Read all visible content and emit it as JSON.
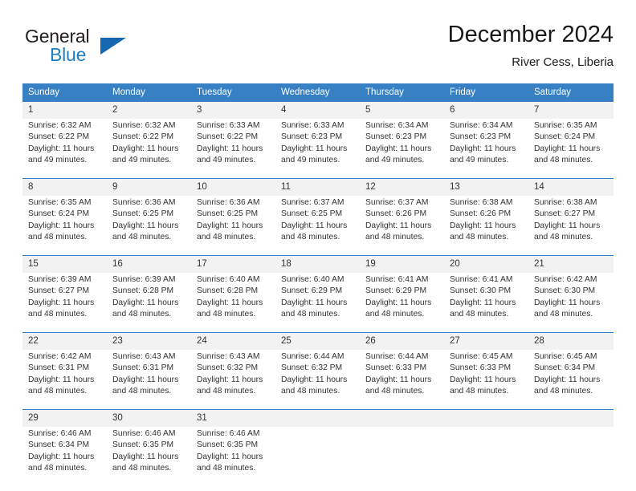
{
  "brand": {
    "name_part1": "General",
    "name_part2": "Blue",
    "triangle_color": "#1567ae",
    "blue_color": "#1f7ec2"
  },
  "header": {
    "title": "December 2024",
    "subtitle": "River Cess, Liberia"
  },
  "theme": {
    "header_bg": "#3780c3",
    "header_text": "#ffffff",
    "daynum_bg": "#f2f2f2",
    "separator": "#3780c3",
    "body_text": "#333333"
  },
  "weekdays": [
    "Sunday",
    "Monday",
    "Tuesday",
    "Wednesday",
    "Thursday",
    "Friday",
    "Saturday"
  ],
  "labels": {
    "sunrise_prefix": "Sunrise:",
    "sunset_prefix": "Sunset:",
    "daylight_prefix": "Daylight:"
  },
  "weeks": [
    [
      {
        "day": "1",
        "sunrise": "Sunrise: 6:32 AM",
        "sunset": "Sunset: 6:22 PM",
        "daylight_line1": "Daylight: 11 hours",
        "daylight_line2": "and 49 minutes."
      },
      {
        "day": "2",
        "sunrise": "Sunrise: 6:32 AM",
        "sunset": "Sunset: 6:22 PM",
        "daylight_line1": "Daylight: 11 hours",
        "daylight_line2": "and 49 minutes."
      },
      {
        "day": "3",
        "sunrise": "Sunrise: 6:33 AM",
        "sunset": "Sunset: 6:22 PM",
        "daylight_line1": "Daylight: 11 hours",
        "daylight_line2": "and 49 minutes."
      },
      {
        "day": "4",
        "sunrise": "Sunrise: 6:33 AM",
        "sunset": "Sunset: 6:23 PM",
        "daylight_line1": "Daylight: 11 hours",
        "daylight_line2": "and 49 minutes."
      },
      {
        "day": "5",
        "sunrise": "Sunrise: 6:34 AM",
        "sunset": "Sunset: 6:23 PM",
        "daylight_line1": "Daylight: 11 hours",
        "daylight_line2": "and 49 minutes."
      },
      {
        "day": "6",
        "sunrise": "Sunrise: 6:34 AM",
        "sunset": "Sunset: 6:23 PM",
        "daylight_line1": "Daylight: 11 hours",
        "daylight_line2": "and 49 minutes."
      },
      {
        "day": "7",
        "sunrise": "Sunrise: 6:35 AM",
        "sunset": "Sunset: 6:24 PM",
        "daylight_line1": "Daylight: 11 hours",
        "daylight_line2": "and 48 minutes."
      }
    ],
    [
      {
        "day": "8",
        "sunrise": "Sunrise: 6:35 AM",
        "sunset": "Sunset: 6:24 PM",
        "daylight_line1": "Daylight: 11 hours",
        "daylight_line2": "and 48 minutes."
      },
      {
        "day": "9",
        "sunrise": "Sunrise: 6:36 AM",
        "sunset": "Sunset: 6:25 PM",
        "daylight_line1": "Daylight: 11 hours",
        "daylight_line2": "and 48 minutes."
      },
      {
        "day": "10",
        "sunrise": "Sunrise: 6:36 AM",
        "sunset": "Sunset: 6:25 PM",
        "daylight_line1": "Daylight: 11 hours",
        "daylight_line2": "and 48 minutes."
      },
      {
        "day": "11",
        "sunrise": "Sunrise: 6:37 AM",
        "sunset": "Sunset: 6:25 PM",
        "daylight_line1": "Daylight: 11 hours",
        "daylight_line2": "and 48 minutes."
      },
      {
        "day": "12",
        "sunrise": "Sunrise: 6:37 AM",
        "sunset": "Sunset: 6:26 PM",
        "daylight_line1": "Daylight: 11 hours",
        "daylight_line2": "and 48 minutes."
      },
      {
        "day": "13",
        "sunrise": "Sunrise: 6:38 AM",
        "sunset": "Sunset: 6:26 PM",
        "daylight_line1": "Daylight: 11 hours",
        "daylight_line2": "and 48 minutes."
      },
      {
        "day": "14",
        "sunrise": "Sunrise: 6:38 AM",
        "sunset": "Sunset: 6:27 PM",
        "daylight_line1": "Daylight: 11 hours",
        "daylight_line2": "and 48 minutes."
      }
    ],
    [
      {
        "day": "15",
        "sunrise": "Sunrise: 6:39 AM",
        "sunset": "Sunset: 6:27 PM",
        "daylight_line1": "Daylight: 11 hours",
        "daylight_line2": "and 48 minutes."
      },
      {
        "day": "16",
        "sunrise": "Sunrise: 6:39 AM",
        "sunset": "Sunset: 6:28 PM",
        "daylight_line1": "Daylight: 11 hours",
        "daylight_line2": "and 48 minutes."
      },
      {
        "day": "17",
        "sunrise": "Sunrise: 6:40 AM",
        "sunset": "Sunset: 6:28 PM",
        "daylight_line1": "Daylight: 11 hours",
        "daylight_line2": "and 48 minutes."
      },
      {
        "day": "18",
        "sunrise": "Sunrise: 6:40 AM",
        "sunset": "Sunset: 6:29 PM",
        "daylight_line1": "Daylight: 11 hours",
        "daylight_line2": "and 48 minutes."
      },
      {
        "day": "19",
        "sunrise": "Sunrise: 6:41 AM",
        "sunset": "Sunset: 6:29 PM",
        "daylight_line1": "Daylight: 11 hours",
        "daylight_line2": "and 48 minutes."
      },
      {
        "day": "20",
        "sunrise": "Sunrise: 6:41 AM",
        "sunset": "Sunset: 6:30 PM",
        "daylight_line1": "Daylight: 11 hours",
        "daylight_line2": "and 48 minutes."
      },
      {
        "day": "21",
        "sunrise": "Sunrise: 6:42 AM",
        "sunset": "Sunset: 6:30 PM",
        "daylight_line1": "Daylight: 11 hours",
        "daylight_line2": "and 48 minutes."
      }
    ],
    [
      {
        "day": "22",
        "sunrise": "Sunrise: 6:42 AM",
        "sunset": "Sunset: 6:31 PM",
        "daylight_line1": "Daylight: 11 hours",
        "daylight_line2": "and 48 minutes."
      },
      {
        "day": "23",
        "sunrise": "Sunrise: 6:43 AM",
        "sunset": "Sunset: 6:31 PM",
        "daylight_line1": "Daylight: 11 hours",
        "daylight_line2": "and 48 minutes."
      },
      {
        "day": "24",
        "sunrise": "Sunrise: 6:43 AM",
        "sunset": "Sunset: 6:32 PM",
        "daylight_line1": "Daylight: 11 hours",
        "daylight_line2": "and 48 minutes."
      },
      {
        "day": "25",
        "sunrise": "Sunrise: 6:44 AM",
        "sunset": "Sunset: 6:32 PM",
        "daylight_line1": "Daylight: 11 hours",
        "daylight_line2": "and 48 minutes."
      },
      {
        "day": "26",
        "sunrise": "Sunrise: 6:44 AM",
        "sunset": "Sunset: 6:33 PM",
        "daylight_line1": "Daylight: 11 hours",
        "daylight_line2": "and 48 minutes."
      },
      {
        "day": "27",
        "sunrise": "Sunrise: 6:45 AM",
        "sunset": "Sunset: 6:33 PM",
        "daylight_line1": "Daylight: 11 hours",
        "daylight_line2": "and 48 minutes."
      },
      {
        "day": "28",
        "sunrise": "Sunrise: 6:45 AM",
        "sunset": "Sunset: 6:34 PM",
        "daylight_line1": "Daylight: 11 hours",
        "daylight_line2": "and 48 minutes."
      }
    ],
    [
      {
        "day": "29",
        "sunrise": "Sunrise: 6:46 AM",
        "sunset": "Sunset: 6:34 PM",
        "daylight_line1": "Daylight: 11 hours",
        "daylight_line2": "and 48 minutes."
      },
      {
        "day": "30",
        "sunrise": "Sunrise: 6:46 AM",
        "sunset": "Sunset: 6:35 PM",
        "daylight_line1": "Daylight: 11 hours",
        "daylight_line2": "and 48 minutes."
      },
      {
        "day": "31",
        "sunrise": "Sunrise: 6:46 AM",
        "sunset": "Sunset: 6:35 PM",
        "daylight_line1": "Daylight: 11 hours",
        "daylight_line2": "and 48 minutes."
      },
      {
        "day": "",
        "sunrise": "",
        "sunset": "",
        "daylight_line1": "",
        "daylight_line2": ""
      },
      {
        "day": "",
        "sunrise": "",
        "sunset": "",
        "daylight_line1": "",
        "daylight_line2": ""
      },
      {
        "day": "",
        "sunrise": "",
        "sunset": "",
        "daylight_line1": "",
        "daylight_line2": ""
      },
      {
        "day": "",
        "sunrise": "",
        "sunset": "",
        "daylight_line1": "",
        "daylight_line2": ""
      }
    ]
  ]
}
